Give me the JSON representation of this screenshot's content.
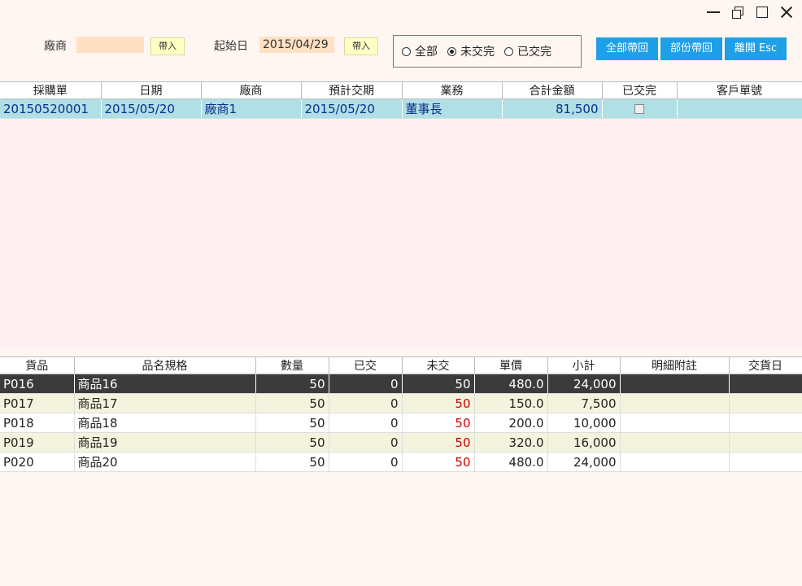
{
  "filters": {
    "vendor_label": "廠商",
    "vendor_value": "",
    "vendor_import": "帶入",
    "start_label": "起始日",
    "start_value": "2015/04/29",
    "start_import": "帶入"
  },
  "status_options": [
    {
      "label": "全部",
      "selected": false
    },
    {
      "label": "未交完",
      "selected": true
    },
    {
      "label": "已交完",
      "selected": false
    }
  ],
  "buttons": {
    "return_all": "全部帶回",
    "return_partial": "部份帶回",
    "exit": "離開 Esc"
  },
  "orders": {
    "columns": [
      "採購單",
      "日期",
      "廠商",
      "預計交期",
      "業務",
      "合計金額",
      "已交完",
      "客戶單號"
    ],
    "rows": [
      {
        "po": "20150520001",
        "date": "2015/05/20",
        "vendor": "廠商1",
        "due": "2015/05/20",
        "sales": "董事長",
        "total": "81,500",
        "done": false,
        "client_no": ""
      }
    ]
  },
  "details": {
    "columns": [
      "貨品",
      "品名規格",
      "數量",
      "已交",
      "未交",
      "單價",
      "小計",
      "明細附註",
      "交貨日"
    ],
    "rows": [
      {
        "code": "P016",
        "name": "商品16",
        "qty": "50",
        "delivered": "0",
        "pending": "50",
        "price": "480.0",
        "subtotal": "24,000",
        "note": "",
        "delivery": ""
      },
      {
        "code": "P017",
        "name": "商品17",
        "qty": "50",
        "delivered": "0",
        "pending": "50",
        "price": "150.0",
        "subtotal": "7,500",
        "note": "",
        "delivery": ""
      },
      {
        "code": "P018",
        "name": "商品18",
        "qty": "50",
        "delivered": "0",
        "pending": "50",
        "price": "200.0",
        "subtotal": "10,000",
        "note": "",
        "delivery": ""
      },
      {
        "code": "P019",
        "name": "商品19",
        "qty": "50",
        "delivered": "0",
        "pending": "50",
        "price": "320.0",
        "subtotal": "16,000",
        "note": "",
        "delivery": ""
      },
      {
        "code": "P020",
        "name": "商品20",
        "qty": "50",
        "delivered": "0",
        "pending": "50",
        "price": "480.0",
        "subtotal": "24,000",
        "note": "",
        "delivery": ""
      }
    ],
    "selected_index": 0
  },
  "colors": {
    "accent": "#1ea0e8",
    "order_row": "#b0e0e6",
    "selected_row": "#3b3b3b",
    "pending_red": "#d00000"
  }
}
